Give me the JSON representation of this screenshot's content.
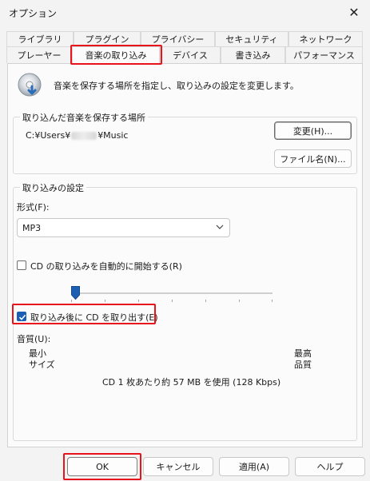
{
  "window": {
    "title": "オプション"
  },
  "tabs": {
    "row1": [
      "ライブラリ",
      "プラグイン",
      "プライバシー",
      "セキュリティ",
      "ネットワーク"
    ],
    "row2": [
      "プレーヤー",
      "音楽の取り込み",
      "デバイス",
      "書き込み",
      "パフォーマンス"
    ],
    "active": "音楽の取り込み"
  },
  "header": {
    "description": "音楽を保存する場所を指定し、取り込みの設定を変更します。"
  },
  "location_group": {
    "label": "取り込んだ音楽を保存する場所",
    "path_prefix": "C:¥Users¥",
    "path_suffix": "¥Music",
    "change_button": "変更(H)...",
    "filename_button": "ファイル名(N)..."
  },
  "rip_group": {
    "label": "取り込みの設定",
    "format_label": "形式(F):",
    "format_value": "MP3",
    "auto_rip_label": "CD の取り込みを自動的に開始する(R)",
    "auto_rip_checked": false,
    "eject_label": "取り込み後に CD を取り出す(E)",
    "eject_checked": true,
    "quality_label": "音質(U):",
    "min_label_1": "最小",
    "min_label_2": "サイズ",
    "max_label_1": "最高",
    "max_label_2": "品質",
    "quality_info": "CD 1 枚あたり約 57 MB を使用 (128 Kbps)",
    "quality_level": 0
  },
  "buttons": {
    "ok": "OK",
    "cancel": "キャンセル",
    "apply": "適用(A)",
    "help": "ヘルプ"
  },
  "colors": {
    "highlight": "#e8131b",
    "accent": "#1a5fb4"
  }
}
